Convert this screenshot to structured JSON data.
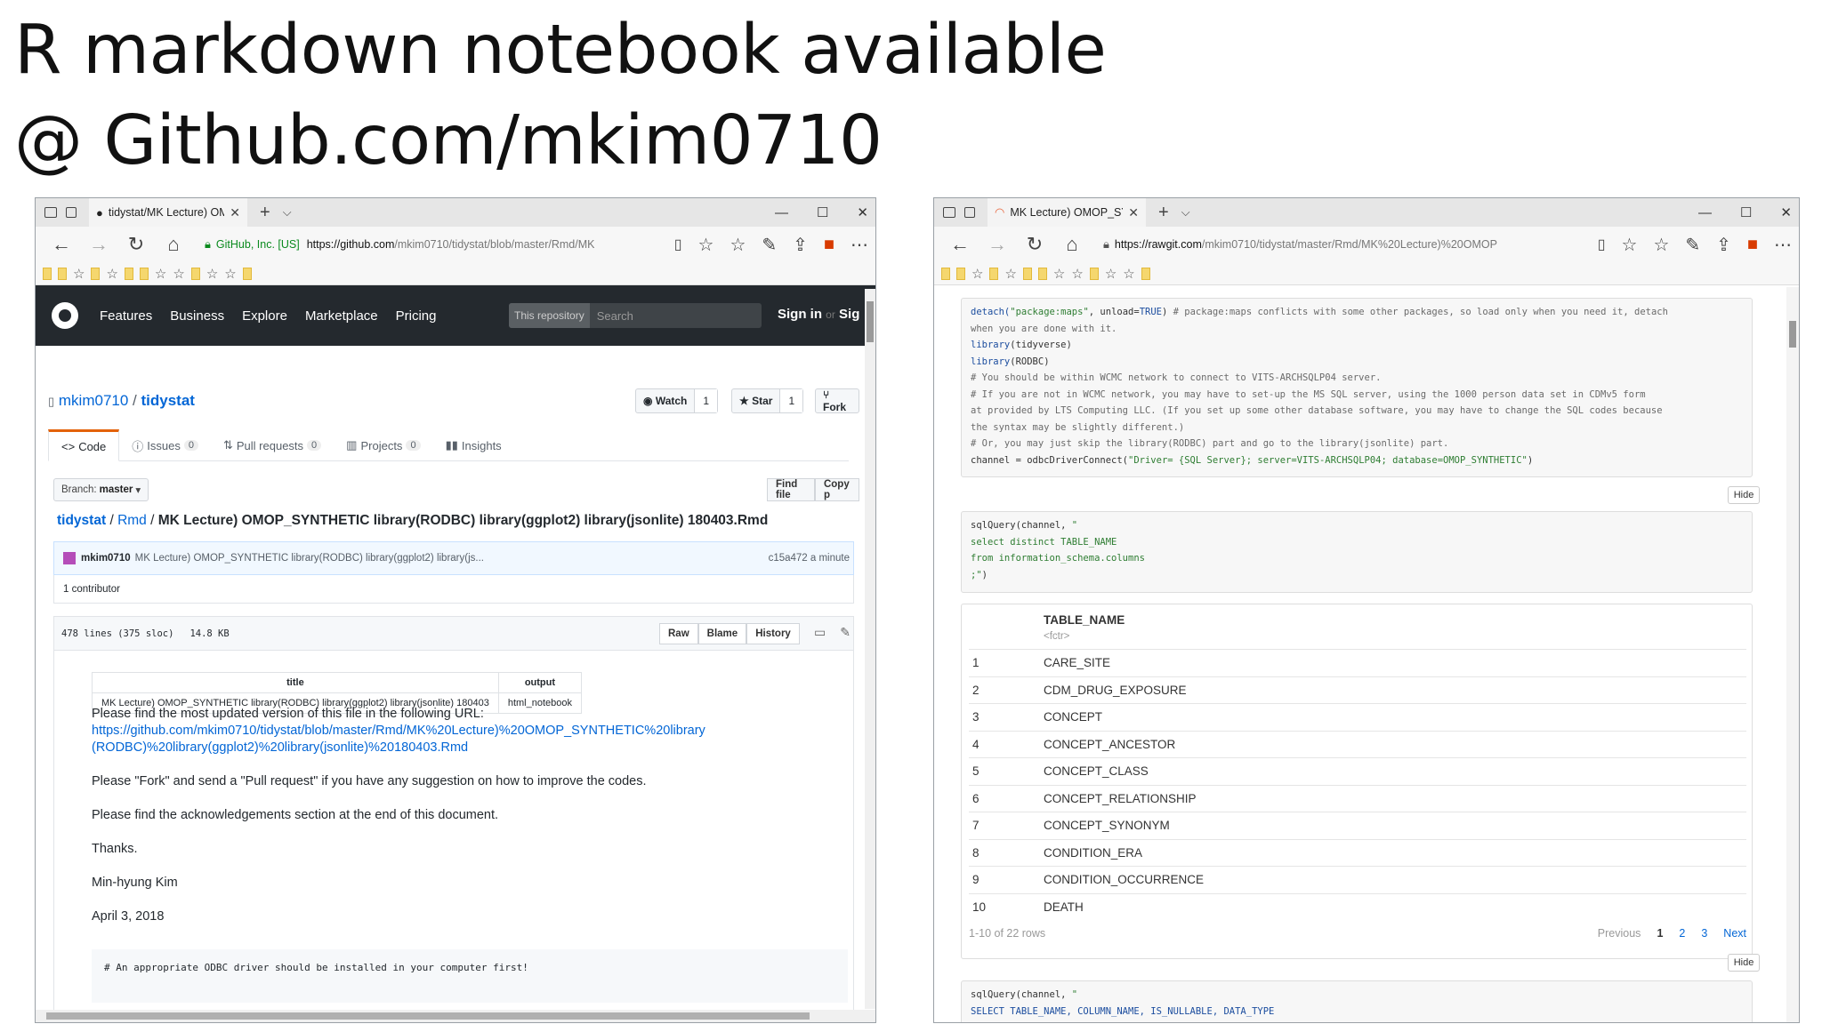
{
  "slide": {
    "title_line1": "R markdown notebook available",
    "title_line2": "@ Github.com/mkim0710"
  },
  "left_browser": {
    "tab_title": "tidystat/MK Lecture) OM",
    "ev_cert": "GitHub, Inc. [US]",
    "url_host": "https://github.com",
    "url_rest": "/mkim0710/tidystat/blob/master/Rmd/MK",
    "github": {
      "nav": [
        "Features",
        "Business",
        "Explore",
        "Marketplace",
        "Pricing"
      ],
      "search_scope": "This repository",
      "search_placeholder": "Search",
      "sign_in": "Sign in",
      "or": "or",
      "sign_up": "Sig",
      "owner": "mkim0710",
      "repo": "tidystat",
      "watch_label": "Watch",
      "watch_count": "1",
      "star_label": "Star",
      "star_count": "1",
      "fork_label": "Fork",
      "tabs": [
        {
          "label": "Code",
          "count": ""
        },
        {
          "label": "Issues",
          "count": "0"
        },
        {
          "label": "Pull requests",
          "count": "0"
        },
        {
          "label": "Projects",
          "count": "0"
        },
        {
          "label": "Insights",
          "count": ""
        }
      ],
      "branch_label": "Branch:",
      "branch_value": "master",
      "find_file": "Find file",
      "copy_path": "Copy p",
      "breadcrumb": {
        "repo": "tidystat",
        "folder": "Rmd",
        "file": "MK Lecture) OMOP_SYNTHETIC library(RODBC) library(ggplot2) library(jsonlite) 180403.Rmd"
      },
      "commit": {
        "author": "mkim0710",
        "message": "MK Lecture) OMOP_SYNTHETIC library(RODBC) library(ggplot2) library(js...",
        "sha": "c15a472 a minute"
      },
      "contributors": "1 contributor",
      "file_lines": "478 lines (375 sloc)",
      "file_size": "14.8 KB",
      "file_buttons": [
        "Raw",
        "Blame",
        "History"
      ],
      "md_table": {
        "headers": [
          "title",
          "output"
        ],
        "row": [
          "MK Lecture) OMOP_SYNTHETIC library(RODBC) library(ggplot2) library(jsonlite) 180403",
          "html_notebook"
        ]
      },
      "para1": "Please find the most updated version of this file in the following URL:",
      "link1": "https://github.com/mkim0710/tidystat/blob/master/Rmd/MK%20Lecture)%20OMOP_SYNTHETIC%20library",
      "link2": "(RODBC)%20library(ggplot2)%20library(jsonlite)%20180403.Rmd",
      "para2": "Please \"Fork\" and send a \"Pull request\" if you have any suggestion on how to improve the codes.",
      "para3": "Please find the acknowledgements section at the end of this document.",
      "para4": "Thanks.",
      "para5": "Min-hyung Kim",
      "para6": "April 3, 2018",
      "code_comment": "# An appropriate ODBC driver should be installed in your computer first!"
    }
  },
  "right_browser": {
    "tab_title": "MK Lecture) OMOP_SYN",
    "url_host": "https://rawgit.com",
    "url_rest": "/mkim0710/tidystat/master/Rmd/MK%20Lecture)%20OMOP",
    "code1": {
      "l1a": "detach(",
      "l1b": "\"package:maps\"",
      "l1c": ", unload=",
      "l1d": "TRUE",
      "l1e": ") ",
      "l1f": "# package:maps conflicts with some other packages, so load only when you need it, detach",
      "l2": "when you are done with it.",
      "l3a": "library",
      "l3b": "(tidyverse)",
      "l4a": "library",
      "l4b": "(RODBC)",
      "l5": "# You should be within WCMC network to connect to VITS-ARCHSQLP04 server.",
      "l6": "# If you are not in WCMC network, you may have to set-up the MS SQL server, using the 1000 person data set in CDMv5 form",
      "l7": "at provided by LTS Computing LLC. (If you set up some other database software, you may have to change the SQL codes because",
      "l8": "the syntax may be slightly different.)",
      "l9": "# Or, you may just skip the library(RODBC) part and go to the library(jsonlite) part.",
      "l10a": "channel = odbcDriverConnect(",
      "l10b": "\"Driver= {SQL Server}; server=VITS-ARCHSQLP04; database=OMOP_SYNTHETIC\"",
      "l10c": ")"
    },
    "hide_label": "Hide",
    "code2": {
      "l1a": "sqlQuery(channel, ",
      "l1b": "\"",
      "l2": "select distinct TABLE_NAME",
      "l3": "from information_schema.columns",
      "l4": ";\"",
      "l4b": ")"
    },
    "table": {
      "header": "TABLE_NAME",
      "type": "<fctr>",
      "rows": [
        {
          "i": "1",
          "v": "CARE_SITE"
        },
        {
          "i": "2",
          "v": "CDM_DRUG_EXPOSURE"
        },
        {
          "i": "3",
          "v": "CONCEPT"
        },
        {
          "i": "4",
          "v": "CONCEPT_ANCESTOR"
        },
        {
          "i": "5",
          "v": "CONCEPT_CLASS"
        },
        {
          "i": "6",
          "v": "CONCEPT_RELATIONSHIP"
        },
        {
          "i": "7",
          "v": "CONCEPT_SYNONYM"
        },
        {
          "i": "8",
          "v": "CONDITION_ERA"
        },
        {
          "i": "9",
          "v": "CONDITION_OCCURRENCE"
        },
        {
          "i": "10",
          "v": "DEATH"
        }
      ],
      "footer": "1-10 of 22 rows",
      "previous": "Previous",
      "pages": [
        "1",
        "2",
        "3"
      ],
      "next": "Next"
    },
    "code3": {
      "l1a": "sqlQuery(channel, ",
      "l1b": "\"",
      "l2": "SELECT TABLE_NAME, COLUMN_NAME, IS_NULLABLE, DATA_TYPE"
    }
  }
}
